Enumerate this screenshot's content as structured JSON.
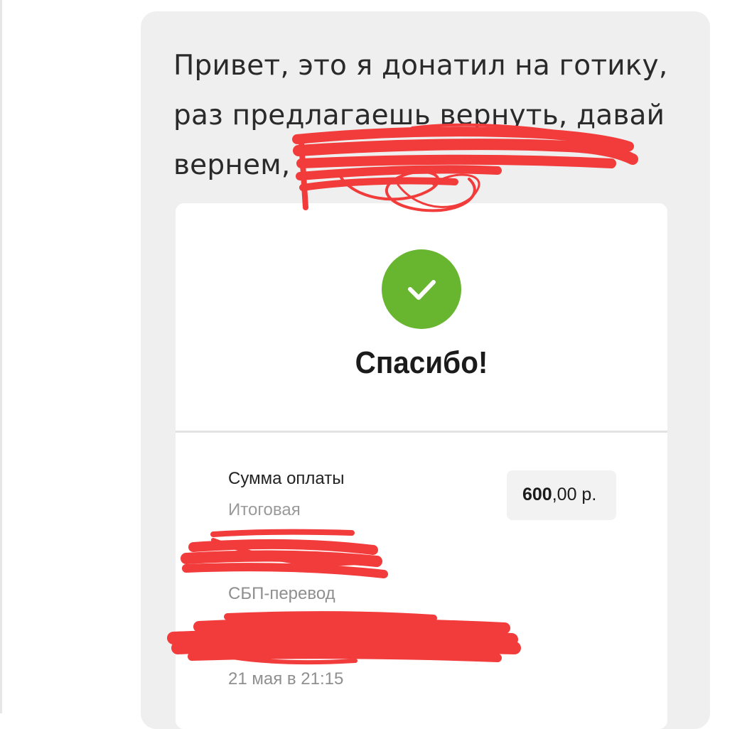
{
  "message": {
    "text": "Привет, это я донатил на готику, раз предлагаешь вернуть, давай вернем,"
  },
  "receipt": {
    "title": "Спасибо!",
    "amount_label": "Сумма оплаты",
    "amount_sublabel": "Итоговая",
    "amount_main": "600",
    "amount_decimal": ",00 р.",
    "payment_method": "СБП-перевод",
    "datetime": "21 мая в 21:15"
  },
  "colors": {
    "success": "#68b52f",
    "redaction": "#f23b3b",
    "bubble": "#efefef"
  },
  "icons": [
    "checkmark-icon"
  ]
}
